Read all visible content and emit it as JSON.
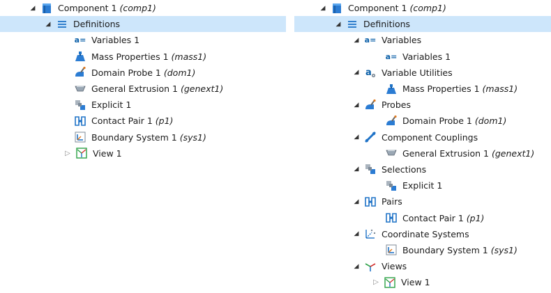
{
  "left": {
    "component": {
      "label": "Component 1",
      "tag": "(comp1)"
    },
    "definitions": {
      "label": "Definitions"
    },
    "items": [
      {
        "label": "Variables 1",
        "tag": ""
      },
      {
        "label": "Mass Properties 1",
        "tag": "(mass1)"
      },
      {
        "label": "Domain Probe 1",
        "tag": "(dom1)"
      },
      {
        "label": "General Extrusion 1",
        "tag": "(genext1)"
      },
      {
        "label": "Explicit 1",
        "tag": ""
      },
      {
        "label": "Contact Pair 1",
        "tag": "(p1)"
      },
      {
        "label": "Boundary System 1",
        "tag": "(sys1)"
      },
      {
        "label": "View 1",
        "tag": ""
      }
    ]
  },
  "right": {
    "component": {
      "label": "Component 1",
      "tag": "(comp1)"
    },
    "definitions": {
      "label": "Definitions"
    },
    "groups": [
      {
        "label": "Variables",
        "child": {
          "label": "Variables 1",
          "tag": ""
        }
      },
      {
        "label": "Variable Utilities",
        "child": {
          "label": "Mass Properties 1",
          "tag": "(mass1)"
        }
      },
      {
        "label": "Probes",
        "child": {
          "label": "Domain Probe 1",
          "tag": "(dom1)"
        }
      },
      {
        "label": "Component Couplings",
        "child": {
          "label": "General Extrusion 1",
          "tag": "(genext1)"
        }
      },
      {
        "label": "Selections",
        "child": {
          "label": "Explicit 1",
          "tag": ""
        }
      },
      {
        "label": "Pairs",
        "child": {
          "label": "Contact Pair 1",
          "tag": "(p1)"
        }
      },
      {
        "label": "Coordinate Systems",
        "child": {
          "label": "Boundary System 1",
          "tag": "(sys1)"
        }
      },
      {
        "label": "Views",
        "child": {
          "label": "View 1",
          "tag": ""
        }
      }
    ]
  },
  "icons": {
    "component": "component-icon",
    "definitions": "definitions-icon",
    "variables": "variables-icon",
    "mass_properties": "mass-properties-icon",
    "probe": "probe-icon",
    "extrusion": "extrusion-icon",
    "selection": "selection-icon",
    "pair": "pair-icon",
    "coordinate_system": "coordinate-system-icon",
    "view": "view-icon",
    "variable_utilities": "variable-utilities-icon",
    "component_couplings": "component-couplings-icon",
    "coordinate_systems": "coordinate-systems-icon",
    "views": "views-icon"
  },
  "text_glyphs": {
    "variables_icon": "a=",
    "variable_utilities_icon": "a",
    "expanded_arrow": "◢",
    "collapsed_arrow": "▷"
  },
  "colors": {
    "selection_bg": "#cde6fb",
    "icon_blue": "#1f73c7",
    "text": "#1a1a1a"
  }
}
